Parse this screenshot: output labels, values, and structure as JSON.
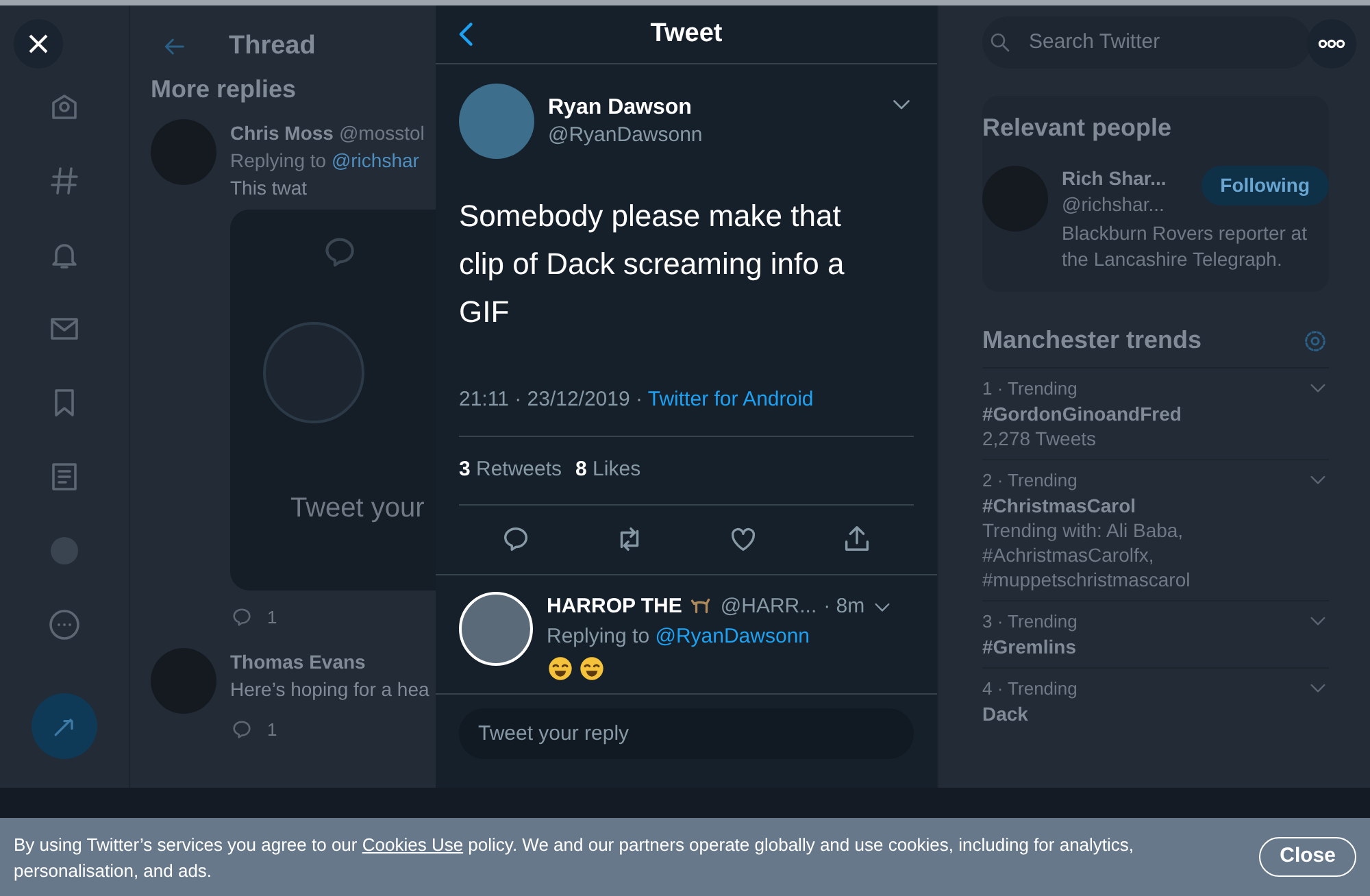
{
  "nav": {
    "items": [
      {
        "kind": "home"
      },
      {
        "kind": "hash"
      },
      {
        "kind": "bell"
      },
      {
        "kind": "mail"
      },
      {
        "kind": "bookmark"
      },
      {
        "kind": "list"
      },
      {
        "kind": "avatar"
      },
      {
        "kind": "more"
      }
    ]
  },
  "thread": {
    "title": "Thread",
    "section": "More replies",
    "replies": [
      {
        "name": "Chris Moss",
        "handle": "@mosstol",
        "replying": "Replying to",
        "mention": "@richshar",
        "text": "This twat",
        "card": {
          "placeholder": "Tweet your"
        },
        "reply_count": "1"
      },
      {
        "name": "Thomas Evans",
        "text": "Here’s hoping for a hea",
        "reply_count": "1"
      }
    ]
  },
  "modal": {
    "title": "Tweet",
    "tweet": {
      "name": "Ryan Dawson",
      "handle": "@RyanDawsonn",
      "text": "Somebody please make that clip of Dack screaming info a GIF",
      "time": "21:11 · 23/12/2019 · ",
      "source": "Twitter for Android",
      "stats": [
        {
          "count": "3",
          "label": "Retweets"
        },
        {
          "count": "8",
          "label": "Likes"
        }
      ]
    },
    "reply": {
      "name": "HARROP THE",
      "handle": "@HARR...",
      "time": "· 8m",
      "replying": "Replying to",
      "mention": "@RyanDawsonn"
    },
    "reply_field": {
      "placeholder": "Tweet your reply"
    }
  },
  "sidebar": {
    "search": {
      "placeholder": "Search Twitter"
    },
    "relevant": {
      "title": "Relevant people",
      "name": "Rich Shar...",
      "handle": "@richshar...",
      "button": "Following",
      "bio": "Blackburn Rovers reporter at the Lancashire Telegraph."
    },
    "trends": {
      "title": "Manchester trends",
      "items": [
        {
          "rank": "1 · Trending",
          "tag": "#GordonGinoandFred",
          "meta": "2,278 Tweets"
        },
        {
          "rank": "2 · Trending",
          "tag": "#ChristmasCarol",
          "meta": "Trending with: Ali Baba, #AchristmasCarolfx, #muppetschristmascarol"
        },
        {
          "rank": "3 · Trending",
          "tag": "#Gremlins"
        },
        {
          "rank": "4 · Trending",
          "tag": "Dack"
        }
      ]
    }
  },
  "cookie_banner": {
    "before": "By using Twitter’s services you agree to our ",
    "link": "Cookies Use",
    "after": " policy. We and our partners operate globally and use cookies, including for analytics, personalisation, and ads.",
    "button": "Close"
  }
}
